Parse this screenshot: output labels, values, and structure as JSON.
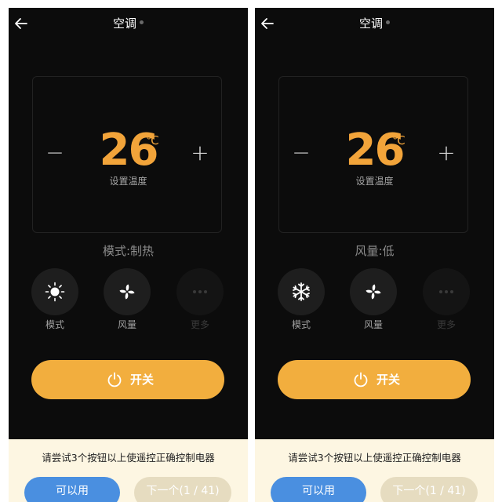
{
  "colors": {
    "background": "#0c0c0c",
    "accent": "#f2a43a",
    "power_button": "#f2ae3e",
    "primary_button": "#4a8fe0",
    "bottom_panel": "#fdf6e2"
  },
  "screens": [
    {
      "header": {
        "back_icon": "arrow-left-icon",
        "title": "空调"
      },
      "temperature": {
        "value": "26",
        "unit": "℃",
        "label": "设置温度",
        "minus": "−",
        "plus": "+"
      },
      "status": "模式:制热",
      "functions": [
        {
          "icon": "sun-icon",
          "label": "模式",
          "enabled": true
        },
        {
          "icon": "fan-icon",
          "label": "风量",
          "enabled": true
        },
        {
          "icon": "more-icon",
          "label": "更多",
          "enabled": false
        }
      ],
      "power": {
        "icon": "power-icon",
        "label": "开关"
      },
      "bottom": {
        "hint": "请尝试3个按钮以上使遥控正确控制电器",
        "ok_label": "可以用",
        "next_label": "下一个(1 / 41)"
      }
    },
    {
      "header": {
        "back_icon": "arrow-left-icon",
        "title": "空调"
      },
      "temperature": {
        "value": "26",
        "unit": "℃",
        "label": "设置温度",
        "minus": "−",
        "plus": "+"
      },
      "status": "风量:低",
      "functions": [
        {
          "icon": "snowflake-icon",
          "label": "模式",
          "enabled": true
        },
        {
          "icon": "fan-icon",
          "label": "风量",
          "enabled": true
        },
        {
          "icon": "more-icon",
          "label": "更多",
          "enabled": false
        }
      ],
      "power": {
        "icon": "power-icon",
        "label": "开关"
      },
      "bottom": {
        "hint": "请尝试3个按钮以上使遥控正确控制电器",
        "ok_label": "可以用",
        "next_label": "下一个(1 / 41)"
      }
    }
  ]
}
